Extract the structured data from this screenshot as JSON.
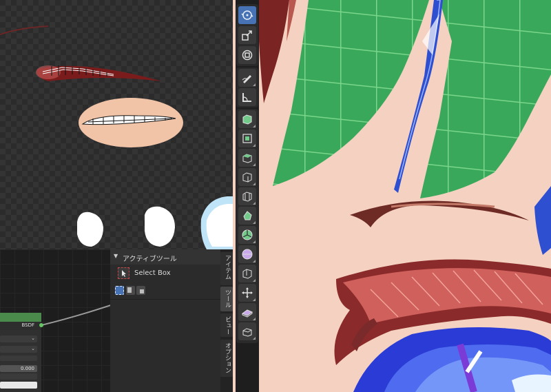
{
  "tool_panel": {
    "title": "アクティブツール",
    "tool_label": "Select Box"
  },
  "sidebar_tabs": [
    "アイテム",
    "ツール",
    "ビュー",
    "オプション"
  ],
  "node": {
    "label": "BSDF",
    "value": "0.000"
  },
  "toolbar_tools": [
    "view-rotate-icon",
    "scale-icon",
    "transform-icon",
    "annotate-icon",
    "measure-icon",
    "add-cube-icon",
    "extrude-icon",
    "inset-icon",
    "bevel-icon",
    "loop-cut-icon",
    "knife-icon",
    "poly-build-icon",
    "spin-icon",
    "smooth-icon",
    "edge-slide-icon",
    "shrink-fatten-icon",
    "shear-icon",
    "rip-icon"
  ],
  "colors": {
    "active_accent": "#4772b3",
    "hair_green": "#3aa85a",
    "skin": "#f4d1c0",
    "eyelash": "#b84a4a",
    "eye_blue": "#2f4fd1",
    "node_header": "#4a8a4a"
  }
}
